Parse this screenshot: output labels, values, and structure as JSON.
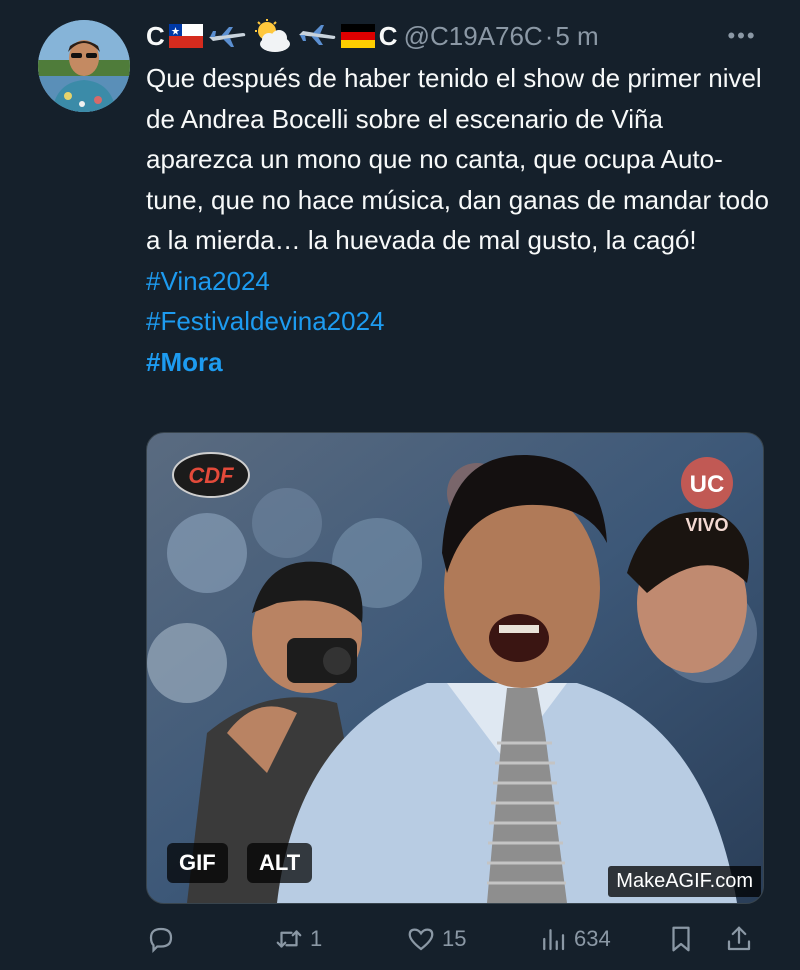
{
  "tweet": {
    "author_prefix": "C",
    "author_suffix": "C",
    "author_emojis": [
      "chile-flag-icon",
      "airplane-icon",
      "sun-behind-cloud-icon",
      "airplane-icon",
      "germany-flag-icon"
    ],
    "handle": "@C19A76C",
    "separator": "·",
    "time": "5 m",
    "more_label": "•••",
    "text": "Que después de haber tenido el show de primer nivel de Andrea Bocelli sobre el escenario de Viña aparezca un mono que no canta, que ocupa Auto-tune, que no hace música, dan ganas de mandar todo a la mierda…  la huevada de mal gusto, la cagó!",
    "hashtags": [
      "#Vina2024",
      "#Festivaldevina2024",
      "#Mora"
    ]
  },
  "media": {
    "gif_badge": "GIF",
    "alt_badge": "ALT",
    "watermark": "MakeAGIF.com",
    "overlay_logo_left": "CDF",
    "overlay_logo_right_top": "UC",
    "overlay_logo_right_bottom": "VIVO"
  },
  "actions": {
    "reply_count": "",
    "retweet_count": "1",
    "like_count": "15",
    "views_count": "634"
  },
  "colors": {
    "background": "#15202b",
    "link": "#1d9bf0",
    "muted": "#8b98a5"
  }
}
